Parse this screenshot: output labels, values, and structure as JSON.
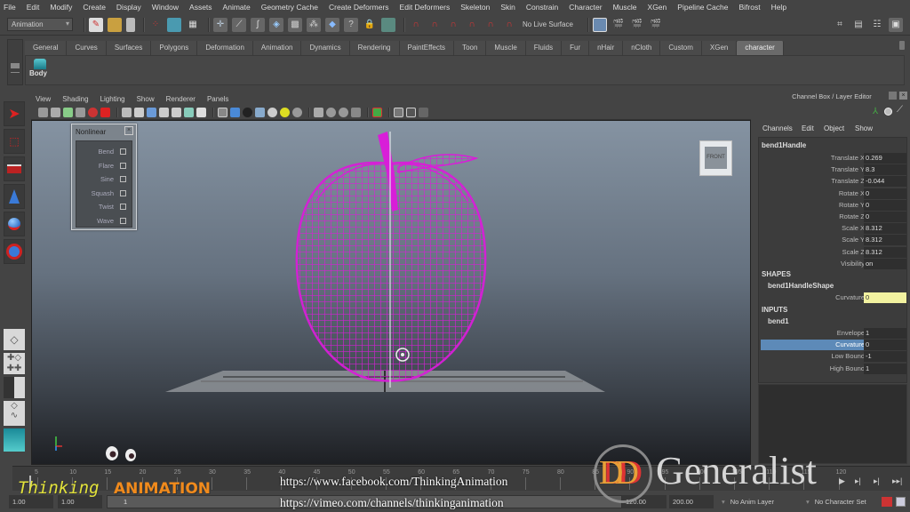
{
  "menubar": {
    "items": [
      "File",
      "Edit",
      "Modify",
      "Create",
      "Display",
      "Window",
      "Assets",
      "Animate",
      "Geometry Cache",
      "Create Deformers",
      "Edit Deformers",
      "Skeleton",
      "Skin",
      "Constrain",
      "Character",
      "Muscle",
      "XGen",
      "Pipeline Cache",
      "Bifrost",
      "Help"
    ]
  },
  "statusline": {
    "mode_selector": "Animation",
    "live_surface": "No Live Surface"
  },
  "shelf": {
    "tabs": [
      "General",
      "Curves",
      "Surfaces",
      "Polygons",
      "Deformation",
      "Animation",
      "Dynamics",
      "Rendering",
      "PaintEffects",
      "Toon",
      "Muscle",
      "Fluids",
      "Fur",
      "nHair",
      "nCloth",
      "Custom",
      "XGen",
      "character"
    ],
    "active_tab": "character",
    "buttons": [
      {
        "label": "Body",
        "icon": "character-body-icon"
      }
    ]
  },
  "viewport": {
    "menu": [
      "View",
      "Shading",
      "Lighting",
      "Show",
      "Renderer",
      "Panels"
    ],
    "view_cube_label": "FRONT",
    "wireframe_color": "#d81ed8"
  },
  "nonlinear_panel": {
    "title": "Nonlinear",
    "items": [
      "Bend",
      "Flare",
      "Sine",
      "Squash",
      "Twist",
      "Wave"
    ]
  },
  "channel_box": {
    "title": "Channel Box / Layer Editor",
    "menu": [
      "Channels",
      "Edit",
      "Object",
      "Show"
    ],
    "object_name": "bend1Handle",
    "channels": [
      {
        "label": "Translate X",
        "value": "0.269"
      },
      {
        "label": "Translate Y",
        "value": "8.3"
      },
      {
        "label": "Translate Z",
        "value": "-0.044"
      },
      {
        "label": "Rotate X",
        "value": "0"
      },
      {
        "label": "Rotate Y",
        "value": "0"
      },
      {
        "label": "Rotate Z",
        "value": "0"
      },
      {
        "label": "Scale X",
        "value": "8.312"
      },
      {
        "label": "Scale Y",
        "value": "8.312"
      },
      {
        "label": "Scale Z",
        "value": "8.312"
      },
      {
        "label": "Visibility",
        "value": "on"
      }
    ],
    "shapes_header": "SHAPES",
    "shape_name": "bend1HandleShape",
    "shape_channels": [
      {
        "label": "Curvature",
        "value": "0"
      }
    ],
    "inputs_header": "INPUTS",
    "input_name": "bend1",
    "input_channels": [
      {
        "label": "Envelope",
        "value": "1"
      },
      {
        "label": "Curvature",
        "value": "0",
        "selected": true
      },
      {
        "label": "Low Bound",
        "value": "-1"
      },
      {
        "label": "High Bound",
        "value": "1"
      }
    ],
    "highlight_color": "#f2f2a0",
    "selected_color": "#5d8ab8"
  },
  "timeline": {
    "ticks": [
      "5",
      "10",
      "15",
      "20",
      "25",
      "30",
      "35",
      "40",
      "45",
      "50",
      "55",
      "60",
      "65",
      "70",
      "75",
      "80",
      "85",
      "90",
      "95",
      "100",
      "105",
      "110",
      "115",
      "120"
    ],
    "current_frame": "1"
  },
  "range_slider": {
    "start_time": "1.00",
    "playback_start": "1.00",
    "range_start_label": "1",
    "playback_end": "120.00",
    "end_time": "200.00",
    "anim_layer": "No Anim Layer",
    "character_set": "No Character Set"
  },
  "watermarks": {
    "thinking": "Thinking",
    "animation": "ANIMATION",
    "facebook": "https://www.facebook.com/ThinkingAnimation",
    "vimeo": "https://vimeo.com/channels/thinkinganimation",
    "brand_mark": "DD",
    "brand_name": "Generalist",
    "thinking_color": "#e2e23a",
    "animation_color": "#f08a1c"
  }
}
